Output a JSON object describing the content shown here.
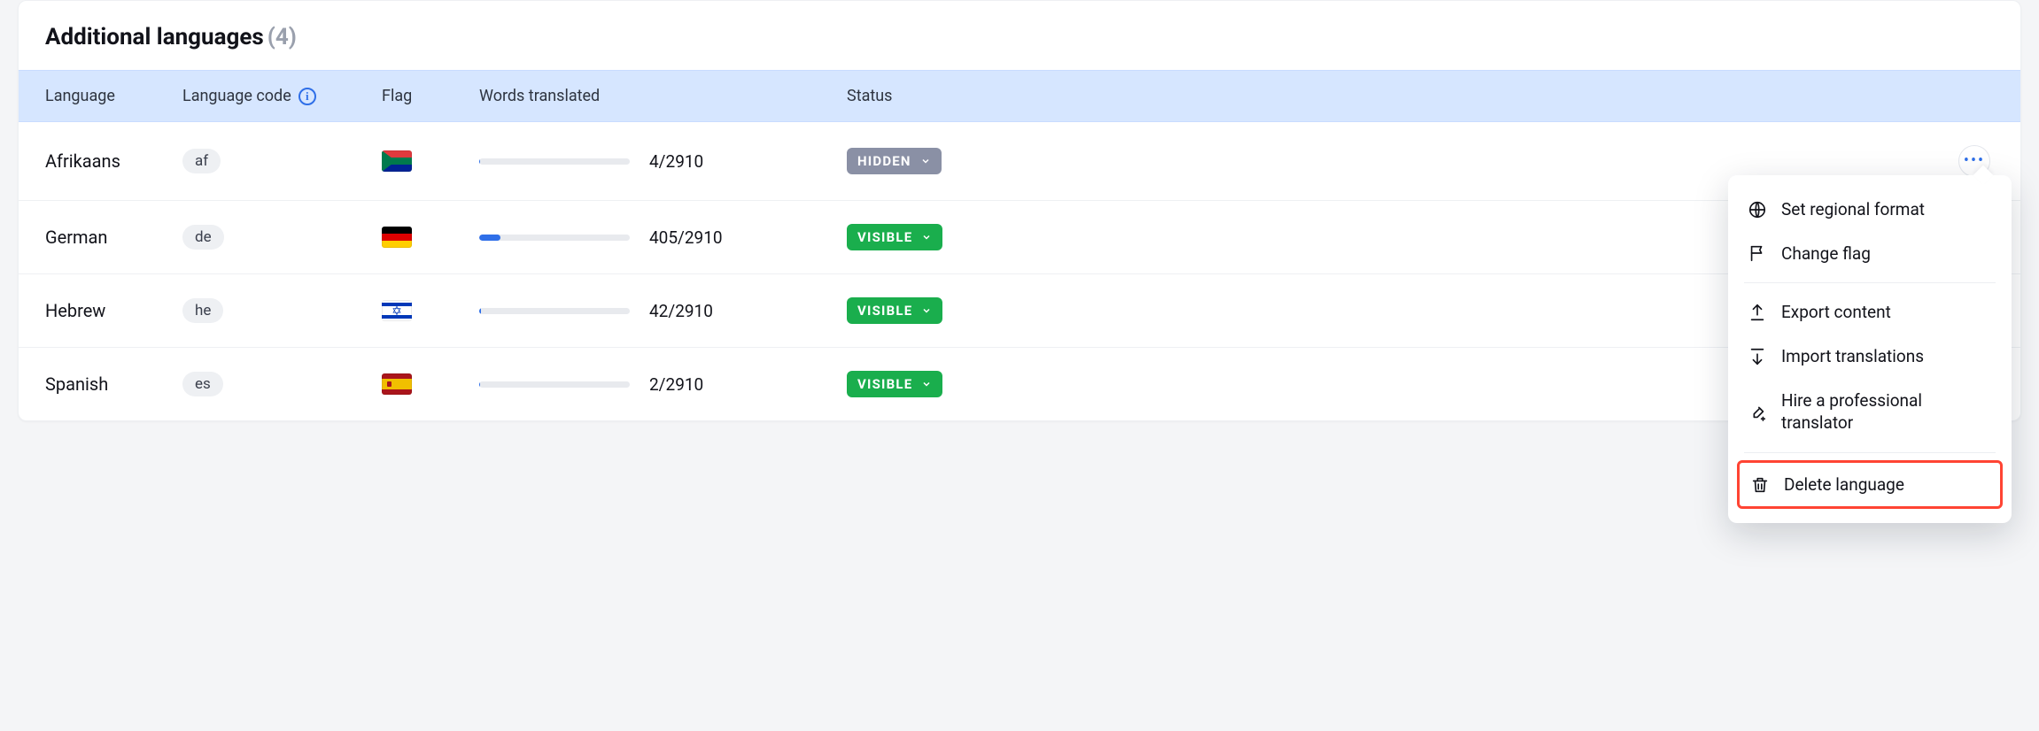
{
  "header": {
    "title": "Additional languages",
    "count": "(4)"
  },
  "columns": {
    "language": "Language",
    "code": "Language code",
    "flag": "Flag",
    "words": "Words translated",
    "status": "Status"
  },
  "rows": [
    {
      "name": "Afrikaans",
      "code": "af",
      "flag": "za",
      "done": 4,
      "total": 2910,
      "countText": "4/2910",
      "status": "HIDDEN",
      "statusClass": "hidden",
      "menuOpen": true
    },
    {
      "name": "German",
      "code": "de",
      "flag": "de",
      "done": 405,
      "total": 2910,
      "countText": "405/2910",
      "status": "VISIBLE",
      "statusClass": "visible",
      "menuOpen": false
    },
    {
      "name": "Hebrew",
      "code": "he",
      "flag": "il",
      "done": 42,
      "total": 2910,
      "countText": "42/2910",
      "status": "VISIBLE",
      "statusClass": "visible",
      "menuOpen": false
    },
    {
      "name": "Spanish",
      "code": "es",
      "flag": "es",
      "done": 2,
      "total": 2910,
      "countText": "2/2910",
      "status": "VISIBLE",
      "statusClass": "visible",
      "menuOpen": false
    }
  ],
  "menu": {
    "regional": "Set regional format",
    "changeFlag": "Change flag",
    "export": "Export content",
    "import": "Import translations",
    "hire": "Hire a professional translator",
    "delete": "Delete language"
  }
}
